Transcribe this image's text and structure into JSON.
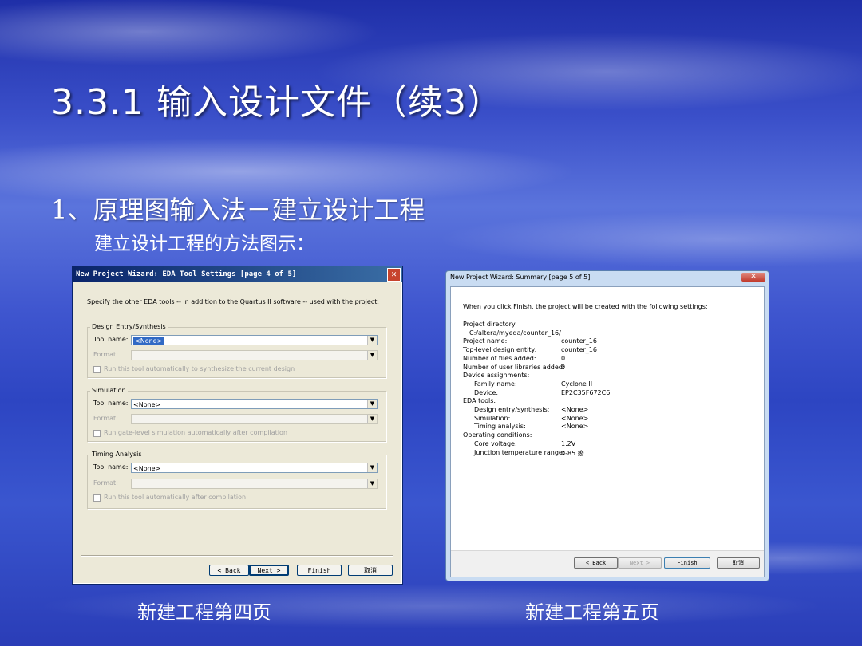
{
  "slide": {
    "title": "3.3.1 输入设计文件（续3）",
    "bullet1": "1、原理图输入法－建立设计工程",
    "bullet2": "建立设计工程的方法图示：",
    "caption_left": "新建工程第四页",
    "caption_right": "新建工程第五页"
  },
  "dialog4": {
    "title": "New Project Wizard: EDA Tool Settings [page 4 of 5]",
    "close": "✕",
    "intro": "Specify the other EDA tools -- in addition to the Quartus II software -- used with the project.",
    "groups": [
      {
        "title": "Design Entry/Synthesis",
        "tool_label": "Tool name:",
        "tool_value": "<None>",
        "format_label": "Format:",
        "check_label": "Run this tool automatically to synthesize the current design"
      },
      {
        "title": "Simulation",
        "tool_label": "Tool name:",
        "tool_value": "<None>",
        "format_label": "Format:",
        "check_label": "Run gate-level simulation automatically after compilation"
      },
      {
        "title": "Timing Analysis",
        "tool_label": "Tool name:",
        "tool_value": "<None>",
        "format_label": "Format:",
        "check_label": "Run this tool automatically after compilation"
      }
    ],
    "buttons": {
      "back": "< Back",
      "next": "Next >",
      "finish": "Finish",
      "cancel": "取消"
    }
  },
  "dialog5": {
    "title": "New Project Wizard: Summary [page 5 of 5]",
    "close": "✕",
    "intro": "When you click Finish, the project will be created with the following settings:",
    "rows": [
      {
        "label": "Project directory:",
        "value": ""
      },
      {
        "label": "C:/altera/myeda/counter_16/",
        "value": ""
      },
      {
        "label": "Project name:",
        "value": "counter_16"
      },
      {
        "label": "Top-level design entity:",
        "value": "counter_16"
      },
      {
        "label": "Number of files added:",
        "value": "0"
      },
      {
        "label": "Number of user libraries added:",
        "value": "0"
      },
      {
        "label": "Device assignments:",
        "value": ""
      },
      {
        "label": "Family name:",
        "value": "Cyclone II"
      },
      {
        "label": "Device:",
        "value": "EP2C35F672C6"
      },
      {
        "label": "EDA tools:",
        "value": ""
      },
      {
        "label": "Design entry/synthesis:",
        "value": "<None>"
      },
      {
        "label": "Simulation:",
        "value": "<None>"
      },
      {
        "label": "Timing analysis:",
        "value": "<None>"
      },
      {
        "label": "Operating conditions:",
        "value": ""
      },
      {
        "label": "Core voltage:",
        "value": "1.2V"
      },
      {
        "label": "Junction temperature range:",
        "value": "0-85 癈"
      }
    ],
    "buttons": {
      "back": "< Back",
      "next": "Next >",
      "finish": "Finish",
      "cancel": "取消"
    }
  }
}
